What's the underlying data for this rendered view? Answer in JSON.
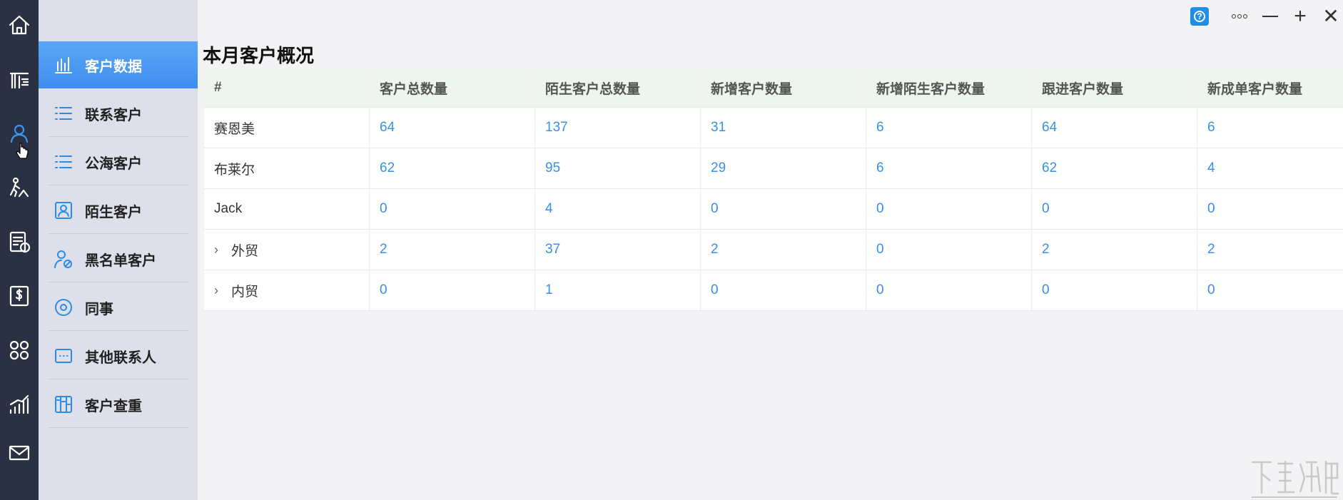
{
  "rail": {
    "items": [
      {
        "name": "home-icon"
      },
      {
        "name": "org-icon"
      },
      {
        "name": "customers-icon"
      },
      {
        "name": "followup-icon"
      },
      {
        "name": "invoice-icon"
      },
      {
        "name": "finance-icon"
      },
      {
        "name": "apps-icon"
      },
      {
        "name": "stats-icon"
      },
      {
        "name": "mail-icon"
      }
    ],
    "active_index": 2
  },
  "sidebar": {
    "items": [
      {
        "label": "客户数据",
        "icon": "bar-chart-icon",
        "active": true
      },
      {
        "label": "联系客户",
        "icon": "list-icon"
      },
      {
        "label": "公海客户",
        "icon": "list-icon"
      },
      {
        "label": "陌生客户",
        "icon": "contact-card-icon"
      },
      {
        "label": "黑名单客户",
        "icon": "user-blocked-icon"
      },
      {
        "label": "同事",
        "icon": "target-icon"
      },
      {
        "label": "其他联系人",
        "icon": "dots-box-icon"
      },
      {
        "label": "客户查重",
        "icon": "columns-icon"
      }
    ]
  },
  "window": {
    "help_label": "?"
  },
  "page": {
    "title": "本月客户概况"
  },
  "table": {
    "headers": [
      "#",
      "客户总数量",
      "陌生客户总数量",
      "新增客户数量",
      "新增陌生客户数量",
      "跟进客户数量",
      "新成单客户数量"
    ],
    "rows": [
      {
        "name": "赛恩美",
        "expandable": false,
        "values": [
          "64",
          "137",
          "31",
          "6",
          "64",
          "6"
        ]
      },
      {
        "name": "布莱尔",
        "expandable": false,
        "values": [
          "62",
          "95",
          "29",
          "6",
          "62",
          "4"
        ]
      },
      {
        "name": "Jack",
        "expandable": false,
        "values": [
          "0",
          "4",
          "0",
          "0",
          "0",
          "0"
        ]
      },
      {
        "name": "外贸",
        "expandable": true,
        "values": [
          "2",
          "37",
          "2",
          "0",
          "2",
          "2"
        ]
      },
      {
        "name": "内贸",
        "expandable": true,
        "values": [
          "0",
          "1",
          "0",
          "0",
          "0",
          "0"
        ]
      }
    ]
  },
  "colors": {
    "rail_bg": "#2a3142",
    "sidebar_bg": "#dde0ea",
    "accent": "#3f8eed",
    "link_number": "#3a8fe6"
  }
}
